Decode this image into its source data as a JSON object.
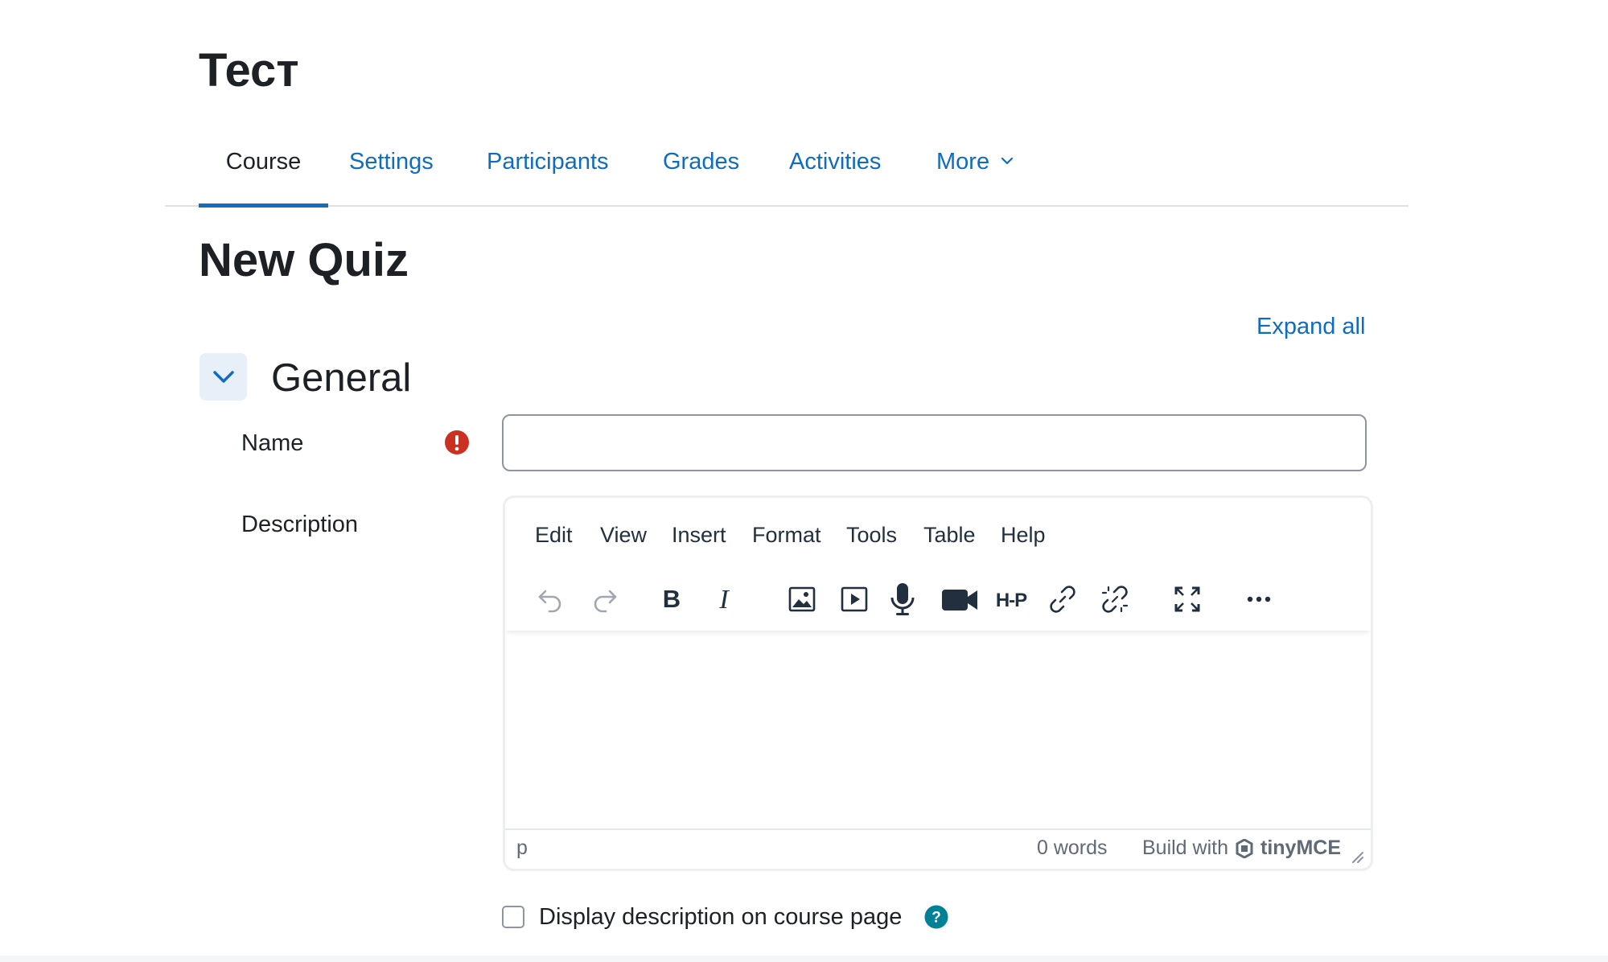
{
  "course": {
    "title": "Тест"
  },
  "nav": {
    "tabs": [
      {
        "label": "Course",
        "active": true
      },
      {
        "label": "Settings"
      },
      {
        "label": "Participants"
      },
      {
        "label": "Grades"
      },
      {
        "label": "Activities"
      },
      {
        "label": "More"
      }
    ]
  },
  "page": {
    "heading": "New Quiz",
    "expand_all": "Expand all"
  },
  "section": {
    "title": "General"
  },
  "form": {
    "name_label": "Name",
    "name_value": "",
    "description_label": "Description"
  },
  "editor": {
    "menu": [
      "Edit",
      "View",
      "Insert",
      "Format",
      "Tools",
      "Table",
      "Help"
    ],
    "toolbar_icons": [
      "undo-icon",
      "redo-icon",
      "bold-icon",
      "italic-icon",
      "image-icon",
      "media-icon",
      "microphone-icon",
      "video-camera-icon",
      "h5p-icon",
      "link-icon",
      "unlink-icon",
      "fullscreen-icon",
      "more-icon"
    ],
    "statusbar": {
      "path": "p",
      "word_count": "0 words",
      "branding_prefix": "Build with",
      "branding_name": "tinyMCE"
    }
  },
  "display_description": {
    "label": "Display description on course page",
    "checked": false
  },
  "colors": {
    "link": "#0f6cbf",
    "required": "#ca3120",
    "help": "#008196",
    "text": "#1d2125"
  }
}
